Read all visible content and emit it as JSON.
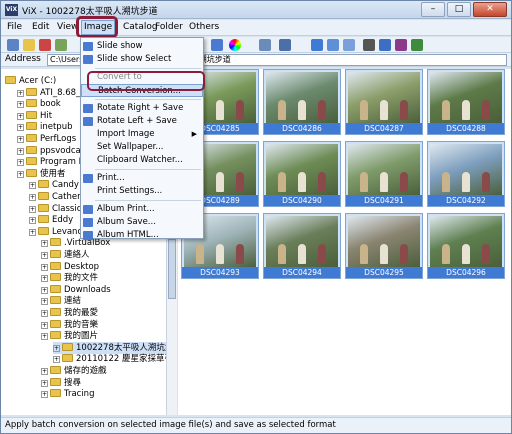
{
  "window": {
    "title": "ViX - 1002278太平吸人溯坑步道",
    "icon_text": "ViX"
  },
  "menubar": [
    "File",
    "Edit",
    "View",
    "Image",
    "Catalog",
    "Folder",
    "Others"
  ],
  "address": {
    "label": "Address",
    "value": "C:\\Users\\...\\我的圖片\\1002278太平吸人溯坑步道"
  },
  "image_menu": {
    "items": [
      {
        "label": "Slide show",
        "icon": "slideshow-icon"
      },
      {
        "label": "Slide show Select",
        "icon": "slideshow-select-icon"
      },
      {
        "label": "Convert to",
        "disabled": true
      },
      {
        "label": "Batch Conversion...",
        "highlighted": true
      },
      {
        "label": "Rotate Right + Save",
        "icon": "rotate-right-icon"
      },
      {
        "label": "Rotate Left + Save",
        "icon": "rotate-left-icon"
      },
      {
        "label": "Import Image",
        "submenu": true
      },
      {
        "label": "Set Wallpaper..."
      },
      {
        "label": "Clipboard Watcher..."
      },
      {
        "label": "Print...",
        "icon": "print-icon"
      },
      {
        "label": "Print Settings..."
      },
      {
        "label": "Album Print...",
        "icon": "album-print-icon"
      },
      {
        "label": "Album Save...",
        "icon": "album-save-icon"
      },
      {
        "label": "Album HTML...",
        "icon": "album-html-icon"
      }
    ]
  },
  "tree": {
    "items": [
      {
        "label": "Acer (C:)",
        "level": 0
      },
      {
        "label": "ATI_8.68_W7",
        "level": 1
      },
      {
        "label": "book",
        "level": 1
      },
      {
        "label": "Hit",
        "level": 1
      },
      {
        "label": "inetpub",
        "level": 1
      },
      {
        "label": "PerfLogs",
        "level": 1
      },
      {
        "label": "ppsvodcache",
        "level": 1
      },
      {
        "label": "Program Files",
        "level": 1
      },
      {
        "label": "使用者",
        "level": 1
      },
      {
        "label": "Candy",
        "level": 2
      },
      {
        "label": "Catherine",
        "level": 2
      },
      {
        "label": "Classic .NET",
        "level": 2
      },
      {
        "label": "Eddy",
        "level": 2
      },
      {
        "label": "Levance",
        "level": 2
      },
      {
        "label": ".VirtualBox",
        "level": 3
      },
      {
        "label": "連絡人",
        "level": 3
      },
      {
        "label": "Desktop",
        "level": 3
      },
      {
        "label": "我的文件",
        "level": 3
      },
      {
        "label": "Downloads",
        "level": 3
      },
      {
        "label": "連結",
        "level": 3
      },
      {
        "label": "我的最愛",
        "level": 3
      },
      {
        "label": "我的音樂",
        "level": 3
      },
      {
        "label": "我的圖片",
        "level": 3
      },
      {
        "label": "1002278太平吸人溯坑步道",
        "level": 4,
        "selected": true
      },
      {
        "label": "20110122 慶星家採草莓",
        "level": 4
      },
      {
        "label": "儲存的遊戲",
        "level": 3
      },
      {
        "label": "搜尋",
        "level": 3
      },
      {
        "label": "Tracing",
        "level": 3
      }
    ]
  },
  "thumbnails": [
    {
      "name": "DSC04285",
      "color": "#7a9a5a"
    },
    {
      "name": "DSC04286",
      "color": "#6b8a6e"
    },
    {
      "name": "DSC04287",
      "color": "#8b9e6a"
    },
    {
      "name": "DSC04288",
      "color": "#5d7a48"
    },
    {
      "name": "DSC04289",
      "color": "#75905e"
    },
    {
      "name": "DSC04290",
      "color": "#6e8c55"
    },
    {
      "name": "DSC04291",
      "color": "#809c6b"
    },
    {
      "name": "DSC04292",
      "color": "#7e9fbf"
    },
    {
      "name": "DSC04293",
      "color": "#9eb4b8"
    },
    {
      "name": "DSC04294",
      "color": "#6a7e5a"
    },
    {
      "name": "DSC04295",
      "color": "#8a8470"
    },
    {
      "name": "DSC04296",
      "color": "#5f8050"
    }
  ],
  "status": {
    "text": "Apply batch conversion on selected image file(s) and save as selected format"
  },
  "colors": {
    "accent": "#3f7ad4",
    "highlight_ring": "#8b1c3a"
  }
}
